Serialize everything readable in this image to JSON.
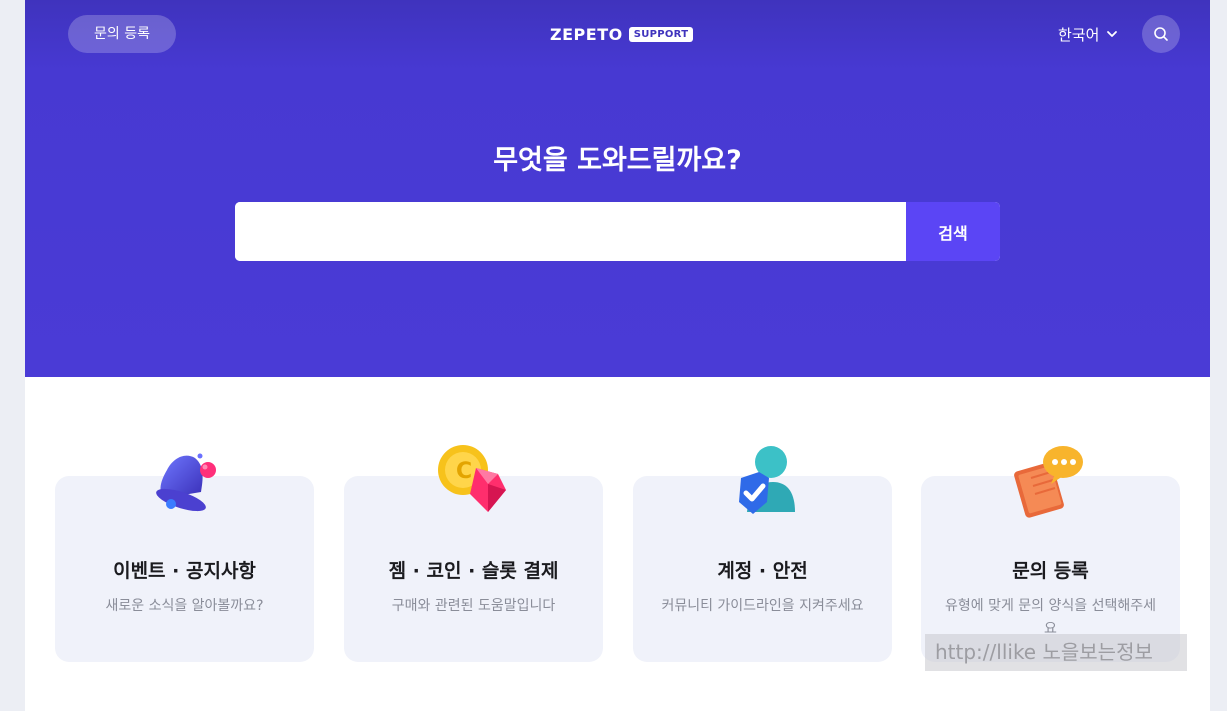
{
  "header": {
    "inquiry_button": "문의 등록",
    "logo_text": "ZEPETO",
    "logo_badge": "SUPPORT",
    "language": "한국어",
    "language_icon": "chevron-down-icon",
    "search_icon": "search-icon"
  },
  "hero": {
    "title": "무엇을 도와드릴까요?",
    "search_value": "",
    "search_placeholder": "",
    "search_button": "검색"
  },
  "categories": [
    {
      "title": "이벤트 · 공지사항",
      "description": "새로운 소식을 알아볼까요?",
      "icon": "bell-icon"
    },
    {
      "title": "젬 · 코인 · 슬롯 결제",
      "description": "구매와 관련된 도움말입니다",
      "icon": "gem-coin-icon"
    },
    {
      "title": "계정 · 안전",
      "description": "커뮤니티 가이드라인을 지켜주세요",
      "icon": "user-shield-icon"
    },
    {
      "title": "문의 등록",
      "description": "유형에 맞게 문의 양식을 선택해주세요",
      "icon": "chat-book-icon"
    }
  ],
  "watermark": "http://llike 노을보는정보",
  "colors": {
    "hero_bg": "#4a3bd6",
    "search_button_bg": "#5b45f5",
    "card_bg": "#f0f2fa"
  }
}
